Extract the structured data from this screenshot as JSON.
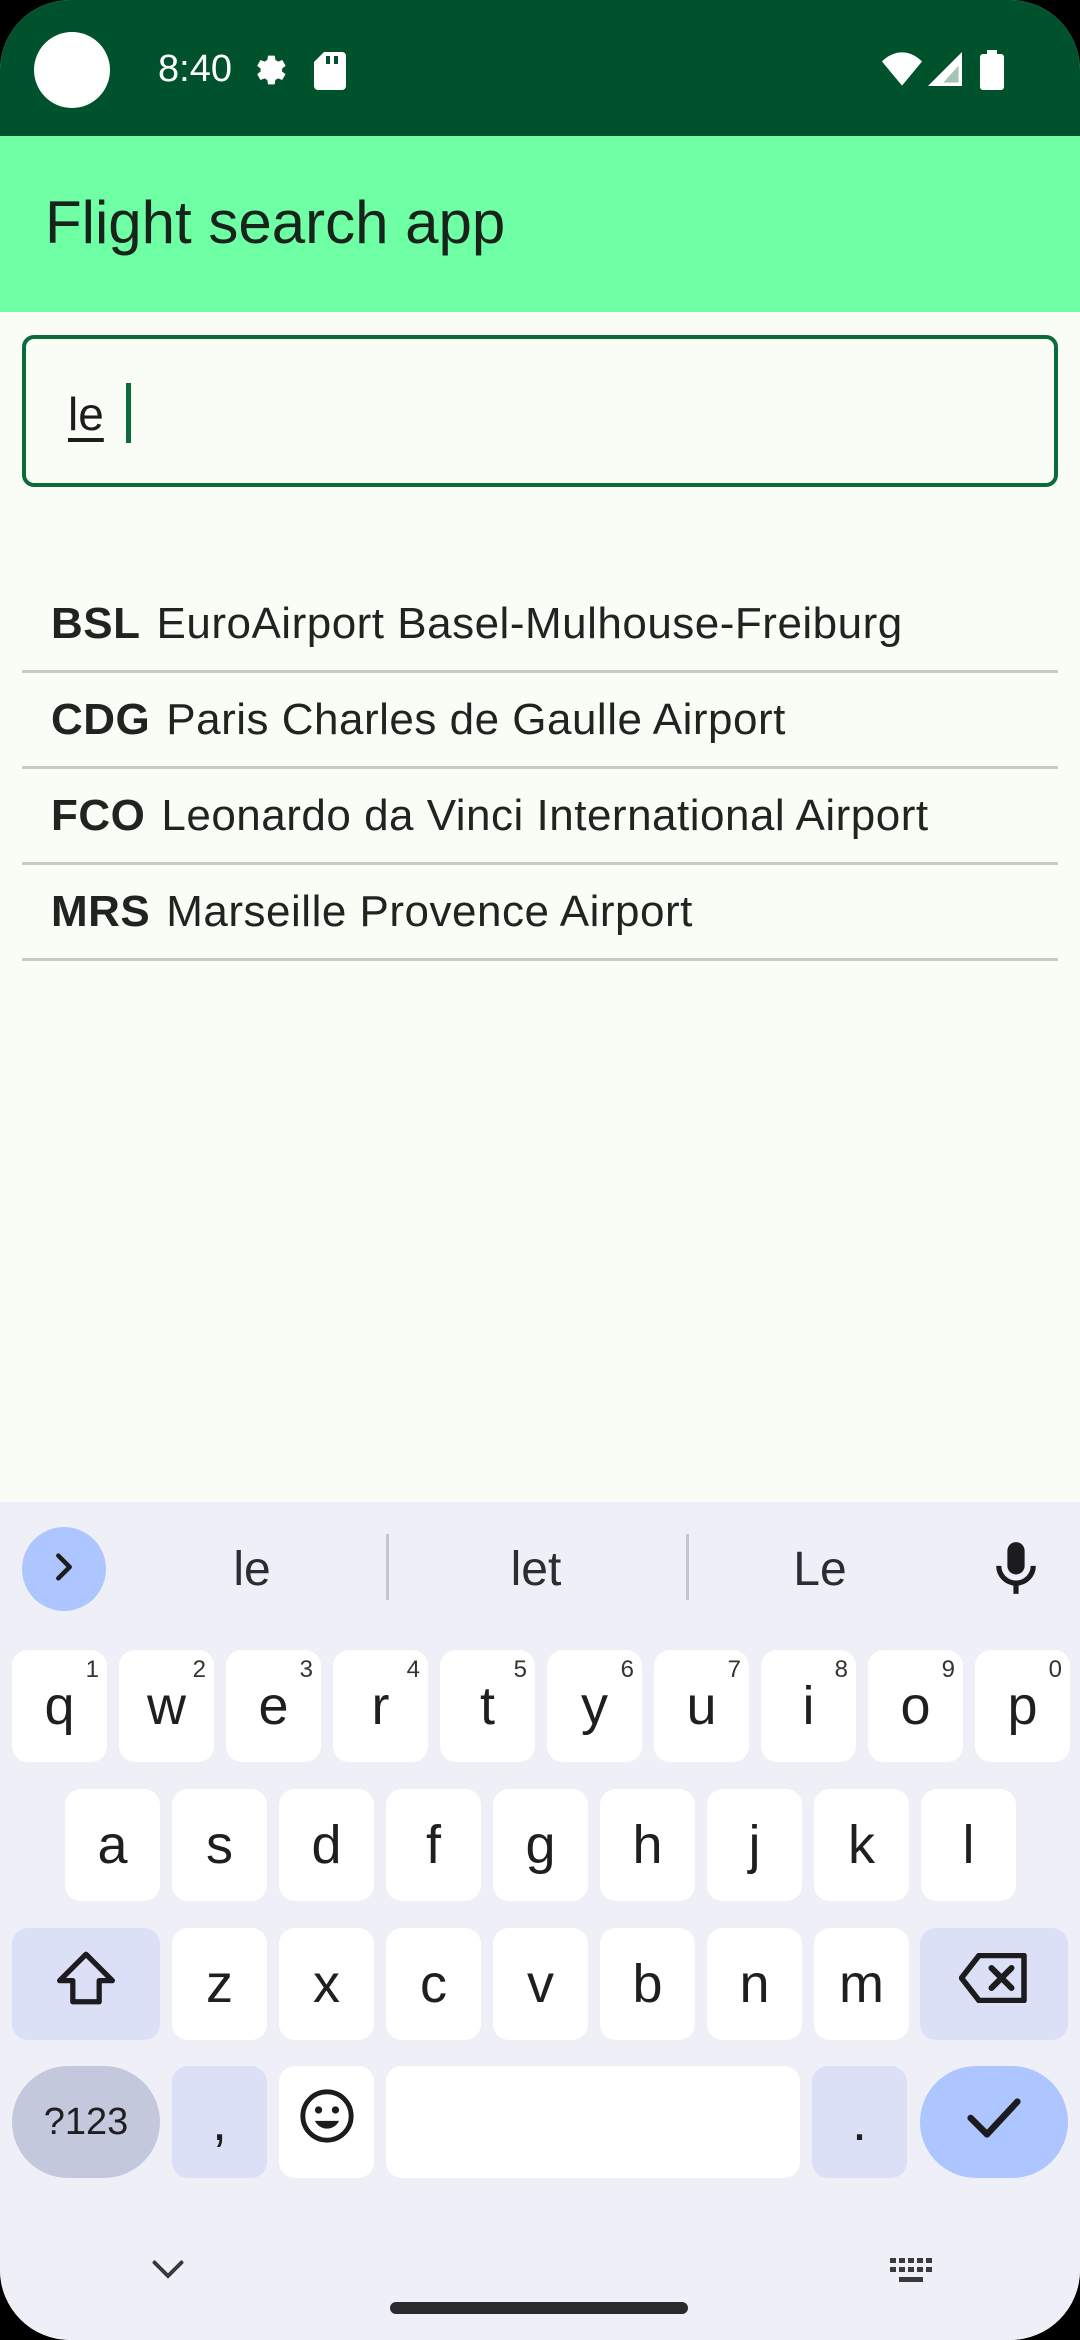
{
  "status_bar": {
    "time": "8:40"
  },
  "app_bar": {
    "title": "Flight search app"
  },
  "search": {
    "value": "le"
  },
  "results": [
    {
      "code": "BSL",
      "name": "EuroAirport Basel-Mulhouse-Freiburg"
    },
    {
      "code": "CDG",
      "name": "Paris Charles de Gaulle Airport"
    },
    {
      "code": "FCO",
      "name": "Leonardo da Vinci International Airport"
    },
    {
      "code": "MRS",
      "name": "Marseille Provence Airport"
    }
  ],
  "keyboard": {
    "suggestions": [
      "le",
      "let",
      "Le"
    ],
    "row1": [
      {
        "k": "q",
        "n": "1"
      },
      {
        "k": "w",
        "n": "2"
      },
      {
        "k": "e",
        "n": "3"
      },
      {
        "k": "r",
        "n": "4"
      },
      {
        "k": "t",
        "n": "5"
      },
      {
        "k": "y",
        "n": "6"
      },
      {
        "k": "u",
        "n": "7"
      },
      {
        "k": "i",
        "n": "8"
      },
      {
        "k": "o",
        "n": "9"
      },
      {
        "k": "p",
        "n": "0"
      }
    ],
    "row2": [
      "a",
      "s",
      "d",
      "f",
      "g",
      "h",
      "j",
      "k",
      "l"
    ],
    "row3": [
      "z",
      "x",
      "c",
      "v",
      "b",
      "n",
      "m"
    ],
    "symbols_label": "?123",
    "comma": ",",
    "period": "."
  },
  "colors": {
    "status_bar": "#00522c",
    "app_bar": "#6fffa5",
    "accent": "#0b6b3a",
    "keyboard_bg": "#eff0f7",
    "enter_key": "#aec6ff"
  },
  "icons": [
    "settings-icon",
    "sd-card-icon",
    "wifi-icon",
    "signal-icon",
    "battery-icon",
    "chevron-right-icon",
    "mic-icon",
    "shift-icon",
    "backspace-icon",
    "emoji-icon",
    "check-icon",
    "chevron-down-icon",
    "keyboard-icon"
  ]
}
